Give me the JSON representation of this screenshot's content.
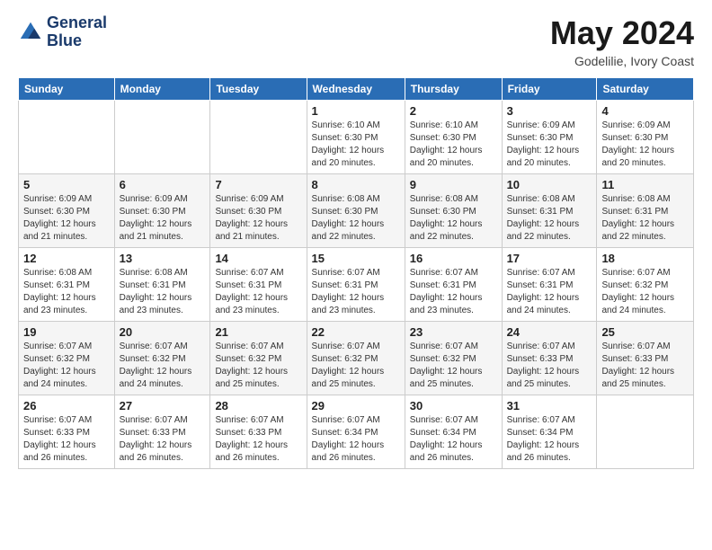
{
  "header": {
    "logo_line1": "General",
    "logo_line2": "Blue",
    "month_title": "May 2024",
    "location": "Godelilie, Ivory Coast"
  },
  "weekdays": [
    "Sunday",
    "Monday",
    "Tuesday",
    "Wednesday",
    "Thursday",
    "Friday",
    "Saturday"
  ],
  "weeks": [
    [
      {
        "day": "",
        "info": ""
      },
      {
        "day": "",
        "info": ""
      },
      {
        "day": "",
        "info": ""
      },
      {
        "day": "1",
        "info": "Sunrise: 6:10 AM\nSunset: 6:30 PM\nDaylight: 12 hours\nand 20 minutes."
      },
      {
        "day": "2",
        "info": "Sunrise: 6:10 AM\nSunset: 6:30 PM\nDaylight: 12 hours\nand 20 minutes."
      },
      {
        "day": "3",
        "info": "Sunrise: 6:09 AM\nSunset: 6:30 PM\nDaylight: 12 hours\nand 20 minutes."
      },
      {
        "day": "4",
        "info": "Sunrise: 6:09 AM\nSunset: 6:30 PM\nDaylight: 12 hours\nand 20 minutes."
      }
    ],
    [
      {
        "day": "5",
        "info": "Sunrise: 6:09 AM\nSunset: 6:30 PM\nDaylight: 12 hours\nand 21 minutes."
      },
      {
        "day": "6",
        "info": "Sunrise: 6:09 AM\nSunset: 6:30 PM\nDaylight: 12 hours\nand 21 minutes."
      },
      {
        "day": "7",
        "info": "Sunrise: 6:09 AM\nSunset: 6:30 PM\nDaylight: 12 hours\nand 21 minutes."
      },
      {
        "day": "8",
        "info": "Sunrise: 6:08 AM\nSunset: 6:30 PM\nDaylight: 12 hours\nand 22 minutes."
      },
      {
        "day": "9",
        "info": "Sunrise: 6:08 AM\nSunset: 6:30 PM\nDaylight: 12 hours\nand 22 minutes."
      },
      {
        "day": "10",
        "info": "Sunrise: 6:08 AM\nSunset: 6:31 PM\nDaylight: 12 hours\nand 22 minutes."
      },
      {
        "day": "11",
        "info": "Sunrise: 6:08 AM\nSunset: 6:31 PM\nDaylight: 12 hours\nand 22 minutes."
      }
    ],
    [
      {
        "day": "12",
        "info": "Sunrise: 6:08 AM\nSunset: 6:31 PM\nDaylight: 12 hours\nand 23 minutes."
      },
      {
        "day": "13",
        "info": "Sunrise: 6:08 AM\nSunset: 6:31 PM\nDaylight: 12 hours\nand 23 minutes."
      },
      {
        "day": "14",
        "info": "Sunrise: 6:07 AM\nSunset: 6:31 PM\nDaylight: 12 hours\nand 23 minutes."
      },
      {
        "day": "15",
        "info": "Sunrise: 6:07 AM\nSunset: 6:31 PM\nDaylight: 12 hours\nand 23 minutes."
      },
      {
        "day": "16",
        "info": "Sunrise: 6:07 AM\nSunset: 6:31 PM\nDaylight: 12 hours\nand 23 minutes."
      },
      {
        "day": "17",
        "info": "Sunrise: 6:07 AM\nSunset: 6:31 PM\nDaylight: 12 hours\nand 24 minutes."
      },
      {
        "day": "18",
        "info": "Sunrise: 6:07 AM\nSunset: 6:32 PM\nDaylight: 12 hours\nand 24 minutes."
      }
    ],
    [
      {
        "day": "19",
        "info": "Sunrise: 6:07 AM\nSunset: 6:32 PM\nDaylight: 12 hours\nand 24 minutes."
      },
      {
        "day": "20",
        "info": "Sunrise: 6:07 AM\nSunset: 6:32 PM\nDaylight: 12 hours\nand 24 minutes."
      },
      {
        "day": "21",
        "info": "Sunrise: 6:07 AM\nSunset: 6:32 PM\nDaylight: 12 hours\nand 25 minutes."
      },
      {
        "day": "22",
        "info": "Sunrise: 6:07 AM\nSunset: 6:32 PM\nDaylight: 12 hours\nand 25 minutes."
      },
      {
        "day": "23",
        "info": "Sunrise: 6:07 AM\nSunset: 6:32 PM\nDaylight: 12 hours\nand 25 minutes."
      },
      {
        "day": "24",
        "info": "Sunrise: 6:07 AM\nSunset: 6:33 PM\nDaylight: 12 hours\nand 25 minutes."
      },
      {
        "day": "25",
        "info": "Sunrise: 6:07 AM\nSunset: 6:33 PM\nDaylight: 12 hours\nand 25 minutes."
      }
    ],
    [
      {
        "day": "26",
        "info": "Sunrise: 6:07 AM\nSunset: 6:33 PM\nDaylight: 12 hours\nand 26 minutes."
      },
      {
        "day": "27",
        "info": "Sunrise: 6:07 AM\nSunset: 6:33 PM\nDaylight: 12 hours\nand 26 minutes."
      },
      {
        "day": "28",
        "info": "Sunrise: 6:07 AM\nSunset: 6:33 PM\nDaylight: 12 hours\nand 26 minutes."
      },
      {
        "day": "29",
        "info": "Sunrise: 6:07 AM\nSunset: 6:34 PM\nDaylight: 12 hours\nand 26 minutes."
      },
      {
        "day": "30",
        "info": "Sunrise: 6:07 AM\nSunset: 6:34 PM\nDaylight: 12 hours\nand 26 minutes."
      },
      {
        "day": "31",
        "info": "Sunrise: 6:07 AM\nSunset: 6:34 PM\nDaylight: 12 hours\nand 26 minutes."
      },
      {
        "day": "",
        "info": ""
      }
    ]
  ]
}
